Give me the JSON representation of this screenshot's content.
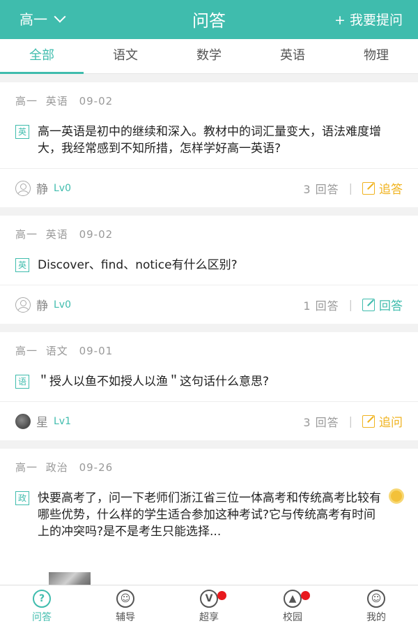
{
  "header": {
    "grade": "高一",
    "title": "问答",
    "ask_label": "+ 我要提问",
    "bg_color": "#3fbcad"
  },
  "tabs": [
    {
      "label": "全部",
      "active": true
    },
    {
      "label": "语文"
    },
    {
      "label": "数学"
    },
    {
      "label": "英语"
    },
    {
      "label": "物理"
    }
  ],
  "questions": [
    {
      "grade": "高一",
      "subject": "英语",
      "date": "09-02",
      "subject_icon": "英",
      "text": "高一英语是初中的继续和深入。教材中的词汇量变大，语法难度增大，我经常感到不知所措，怎样学好高一英语?",
      "user": "静",
      "level": "Lv0",
      "answers": "3 回答",
      "action": "追答",
      "action_color": "#f0b31f"
    },
    {
      "grade": "高一",
      "subject": "英语",
      "date": "09-02",
      "subject_icon": "英",
      "text": "Discover、find、notice有什么区别?",
      "user": "静",
      "level": "Lv0",
      "answers": "1 回答",
      "action": "回答",
      "action_color": "#3fbcad"
    },
    {
      "grade": "高一",
      "subject": "语文",
      "date": "09-01",
      "subject_icon": "语",
      "text": "＂授人以鱼不如授人以渔＂这句话什么意思?",
      "user": "星",
      "level": "Lv1",
      "answers": "3 回答",
      "action": "追问",
      "action_color": "#f0b31f"
    },
    {
      "grade": "高一",
      "subject": "政治",
      "date": "09-26",
      "subject_icon": "政",
      "text": "快要高考了，问一下老师们浙江省三位一体高考和传统高考比较有哪些优势，什么样的学生适合参加这种考试?它与传统高考有时间上的冲突吗?是不是考生只能选择..."
    }
  ],
  "bottom_nav": [
    {
      "label": "问答",
      "icon": "question-icon",
      "glyph": "?",
      "active": true
    },
    {
      "label": "辅导",
      "icon": "person-icon",
      "glyph": "☺"
    },
    {
      "label": "超享",
      "icon": "share-icon",
      "glyph": "V",
      "badge": true
    },
    {
      "label": "校园",
      "icon": "graduation-cap-icon",
      "glyph": "▲",
      "badge": true
    },
    {
      "label": "我的",
      "icon": "profile-icon",
      "glyph": "☺"
    }
  ]
}
